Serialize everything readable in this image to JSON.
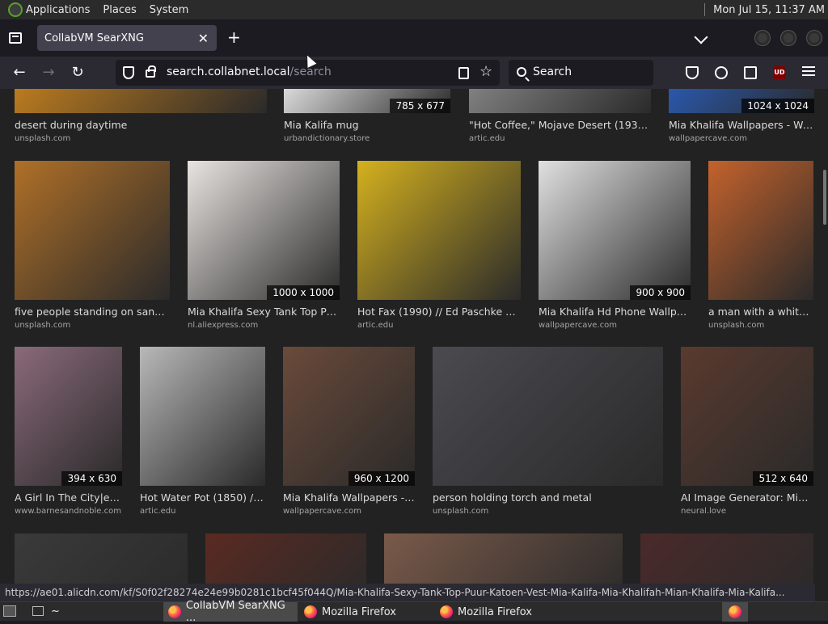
{
  "top_panel": {
    "menu": [
      "Applications",
      "Places",
      "System"
    ],
    "clock": "Mon Jul 15, 11:37 AM"
  },
  "browser": {
    "tab_title": "CollabVM SearXNG",
    "url_host": "search.collabnet.local",
    "url_path": "/search",
    "search_placeholder": "Search",
    "ublock_badge": "UD"
  },
  "results": [
    {
      "title": "desert during daytime",
      "source": "unsplash.com",
      "res": "",
      "color": "#c8821e"
    },
    {
      "title": "Mia Kalifa mug",
      "source": "urbandictionary.store",
      "res": "785 x 677",
      "color": "#f0f0f0"
    },
    {
      "title": "\"Hot Coffee,\" Mojave Desert (1937, p...",
      "source": "artic.edu",
      "res": "",
      "color": "#8a8a8a"
    },
    {
      "title": "Mia Khalifa Wallpapers - Wall...",
      "source": "wallpapercave.com",
      "res": "1024 x 1024",
      "color": "#2a5fbf"
    },
    {
      "title": "five people standing on sand d...",
      "source": "unsplash.com",
      "res": "",
      "color": "#b07028"
    },
    {
      "title": "Mia Khalifa Sexy Tank Top Puu...",
      "source": "nl.aliexpress.com",
      "res": "1000 x 1000",
      "color": "#e8e4e0"
    },
    {
      "title": "Hot Fax (1990) // Ed Paschke A...",
      "source": "artic.edu",
      "res": "",
      "color": "#d4b11e"
    },
    {
      "title": "Mia Khalifa Hd Phone Wallpap...",
      "source": "wallpapercave.com",
      "res": "900 x 900",
      "color": "#e0e0e0"
    },
    {
      "title": "a man with a white t...",
      "source": "unsplash.com",
      "res": "",
      "color": "#c4622c"
    },
    {
      "title": "A Girl In The City|eB...",
      "source": "www.barnesandnoble.com",
      "res": "394 x 630",
      "color": "#8a6a7a"
    },
    {
      "title": "Hot Water Pot (1850) // ...",
      "source": "artic.edu",
      "res": "",
      "color": "#b8b8b8"
    },
    {
      "title": "Mia Khalifa Wallpapers - ...",
      "source": "wallpapercave.com",
      "res": "960 x 1200",
      "color": "#6a4a3a"
    },
    {
      "title": "person holding torch and metal",
      "source": "unsplash.com",
      "res": "",
      "color": "#4a4a50"
    },
    {
      "title": "AI Image Generator: Mia K...",
      "source": "neural.love",
      "res": "512 x 640",
      "color": "#5a3a2e"
    },
    {
      "title": "",
      "source": "",
      "res": "",
      "color": "#3a3a3a"
    },
    {
      "title": "",
      "source": "",
      "res": "",
      "color": "#5a2a22"
    },
    {
      "title": "",
      "source": "",
      "res": "",
      "color": "#7a5a4a"
    },
    {
      "title": "",
      "source": "",
      "res": "",
      "color": "#4a2a2a"
    }
  ],
  "status_url": "https://ae01.alicdn.com/kf/S0f02f28274e24e99b0281c1bcf45f044Q/Mia-Khalifa-Sexy-Tank-Top-Puur-Katoen-Vest-Mia-Kalifa-Mia-Khalifah-Mian-Khalifa-Mia-Kalifa...",
  "taskbar": {
    "items": [
      "CollabVM SearXNG ...",
      "Mozilla Firefox",
      "Mozilla Firefox"
    ],
    "tilde": "~"
  }
}
